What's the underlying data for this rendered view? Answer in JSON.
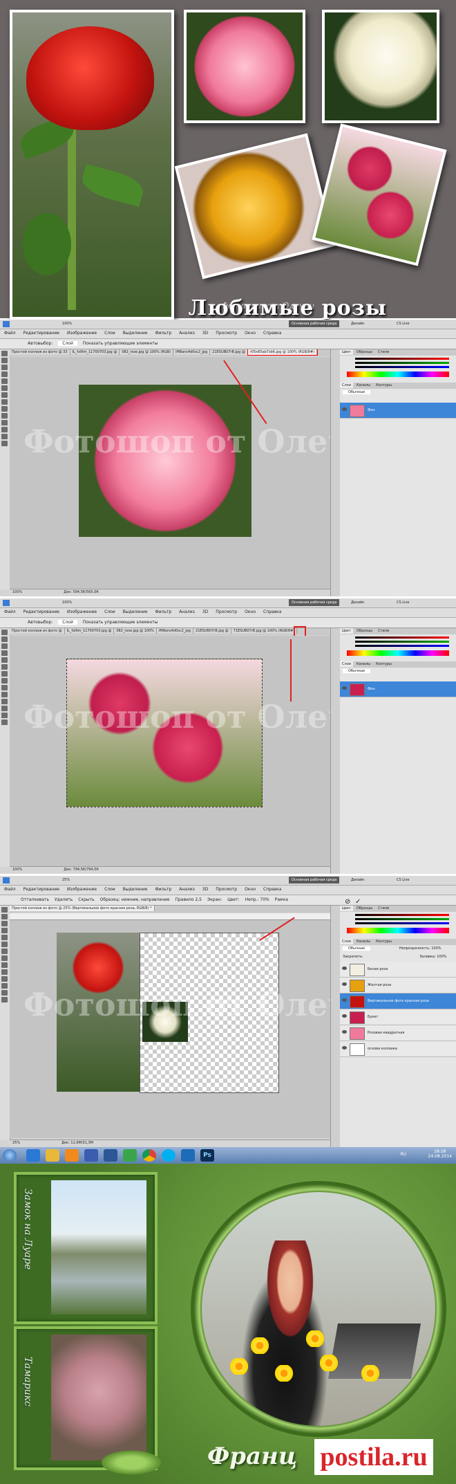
{
  "collage": {
    "title": "Любимые розы",
    "caption": "Фотошоп от Олечки"
  },
  "watermark": "Фотошоп от Олечки",
  "photoshop": {
    "menu": [
      "Файл",
      "Редактирование",
      "Изображение",
      "Слои",
      "Выделение",
      "Фильтр",
      "Анализ",
      "3D",
      "Просмотр",
      "Окно",
      "Справка"
    ],
    "zoom": "100%",
    "workspace_label": "Основная рабочая среда",
    "design_label": "Дизайн",
    "cs_live": "CS Live",
    "autoselect_label": "Автовыбор:",
    "autoselect_value": "Слой",
    "show_controls": "Показать управляющие элементы",
    "panel_tabs_1": [
      "Цвет",
      "Образцы",
      "Стили"
    ],
    "panel_tabs_2": [
      "Слои",
      "Каналы",
      "Контуры"
    ],
    "blend_mode": "Обычные",
    "opacity_label": "Непрозрачность:",
    "opacity_value": "100%",
    "fill_label": "Заливка:",
    "fill_value": "100%",
    "lock_label": "Закрепить:",
    "rgb": [
      {
        "ch": "R",
        "val": "91"
      },
      {
        "ch": "G",
        "val": "86"
      },
      {
        "ch": "B",
        "val": "91"
      }
    ],
    "win1": {
      "tabs": [
        "Простой коллаж из фото @ 33",
        "IL_fxl6m_11700703.jpg @",
        "082_rose.jpg @ 100% (RGB)",
        "IM8ans4d0sc2_jpg",
        "21ESUB07rB.jpg @",
        "r05x65ab7zb6.jpg @ 100% (RGB/8#)"
      ],
      "active_tab": 5,
      "status": "Док: 594,5К/565,0К",
      "zoom_status": "100%",
      "layer_name": "Фон"
    },
    "win2": {
      "tabs": [
        "Простой коллаж из фото @",
        "IL_fxl6m_11700703.jpg @",
        "082_rose.jpg @ 100%",
        "IM8ans4d0sc2_jpg",
        "21ESUB07rB.jpg @",
        "71ESUB07rB.jpg @ 100% (RGB/8#)"
      ],
      "active_tab": 5,
      "status": "Док: 794,5К/794,5К",
      "zoom_status": "100%",
      "layer_name": "Фон"
    },
    "win3": {
      "tabs": [
        "Простой коллаж из фото @ 25% (Вертикальное фото красная роза, RGB/8) *"
      ],
      "active_tab": 0,
      "status": "Док: 11,6М/31,3М",
      "zoom_status": "25%",
      "options": [
        "Отталкивать",
        "Удалить",
        "Скрыть",
        "Образец: нижние, направление",
        "Правило 2,5",
        "Экран:",
        "Цвет:",
        "Непр.: 70%",
        "Рамка"
      ],
      "layers": [
        "Белая роза",
        "Желтая роза",
        "Вертикальное фото красная роза",
        "Букет",
        "Розовая квадратная",
        "основа коллажа"
      ],
      "selected_layer": 2
    }
  },
  "taskbar": {
    "lang": "RU",
    "time": "18:28",
    "date": "24.08.2014",
    "app_label": "Ps"
  },
  "green": {
    "vertical_1": "Замок на Луаре",
    "vertical_2": "Тамарикс",
    "signature": "Франц",
    "site": "postila.ru"
  },
  "colors": {
    "collage_bg": "#6a6465",
    "ps_selected": "#3d86d8",
    "arrow": "#e02020",
    "green_bg": "#5f9336"
  }
}
